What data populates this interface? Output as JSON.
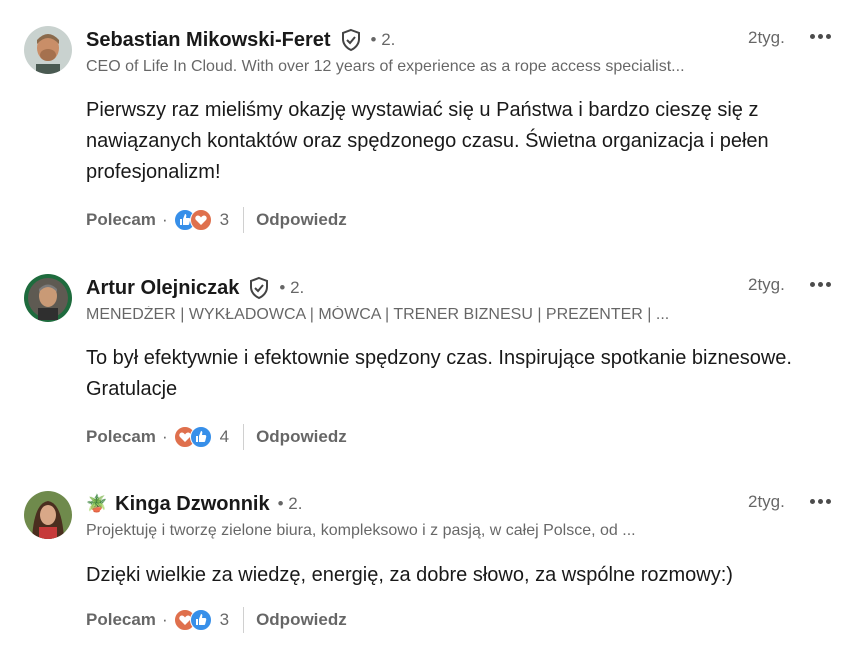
{
  "comments": [
    {
      "name": "Sebastian Mikowski-Feret",
      "degree": "• 2.",
      "headline": "CEO of Life In Cloud. With over 12 years of experience as a rope access specialist...",
      "time": "2tyg.",
      "body": "Pierwszy raz mieliśmy okazję wystawiać się u Państwa i bardzo cieszę się z nawiązanych kontaktów oraz spędzonego czasu. Świetna organizacja i pełen profesjonalizm!",
      "like_label": "Polecam",
      "reaction_count": "3",
      "reply_label": "Odpowiedz",
      "reactions": [
        "like-icon",
        "love-icon"
      ]
    },
    {
      "name": "Artur Olejniczak",
      "degree": "• 2.",
      "headline": "MENEDŻER | WYKŁADOWCA | MÓWCA | TRENER BIZNESU | PREZENTER | ...",
      "time": "2tyg.",
      "body": "To był efektywnie i efektownie spędzony czas. Inspirujące spotkanie biznesowe. Gratulacje",
      "like_label": "Polecam",
      "reaction_count": "4",
      "reply_label": "Odpowiedz",
      "reactions": [
        "love-icon",
        "like-icon"
      ]
    },
    {
      "name": "Kinga Dzwonnik",
      "plant_emoji": "🪴",
      "degree": "• 2.",
      "headline": "Projektuję i tworzę zielone biura, kompleksowo i z pasją, w całej Polsce, od ...",
      "time": "2tyg.",
      "body": "Dzięki wielkie za wiedzę, energię, za dobre słowo, za wspólne rozmowy:)",
      "like_label": "Polecam",
      "reaction_count": "3",
      "reply_label": "Odpowiedz",
      "reactions": [
        "love-icon",
        "like-icon"
      ]
    }
  ],
  "separator": "·",
  "colors": {
    "like": "#378fe9",
    "love": "#df704d",
    "text_muted": "#666666"
  }
}
